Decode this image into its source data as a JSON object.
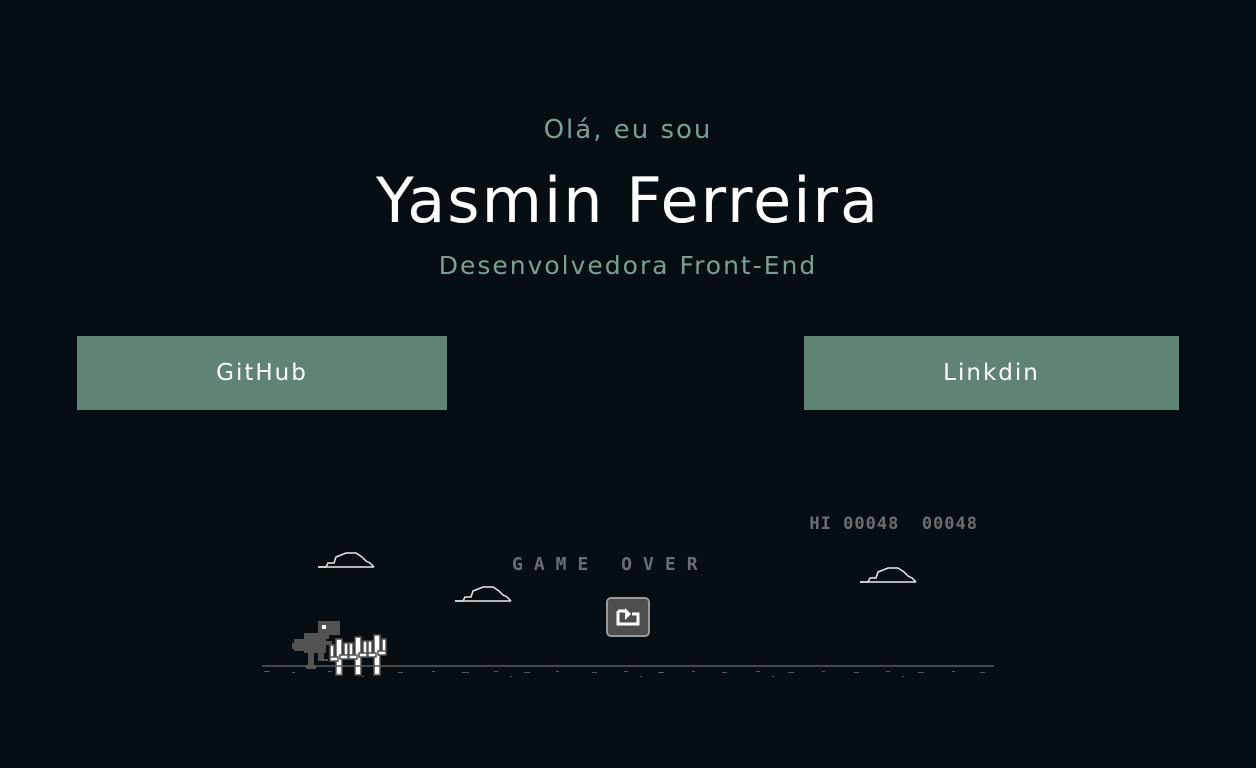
{
  "hero": {
    "greeting": "Olá, eu sou",
    "name": "Yasmin Ferreira",
    "role": "Desenvolvedora Front-End"
  },
  "links": {
    "github_label": "GitHub",
    "linkedin_label": "Linkdin"
  },
  "game": {
    "hi_label": "HI",
    "hi_score": "00048",
    "current_score": "00048",
    "game_over_text": "GAME OVER",
    "restart_icon": "restart-icon"
  },
  "colors": {
    "background": "#060e14",
    "accent": "#608474",
    "muted_text": "#7b9f92",
    "game_gray": "#6b6e70"
  }
}
